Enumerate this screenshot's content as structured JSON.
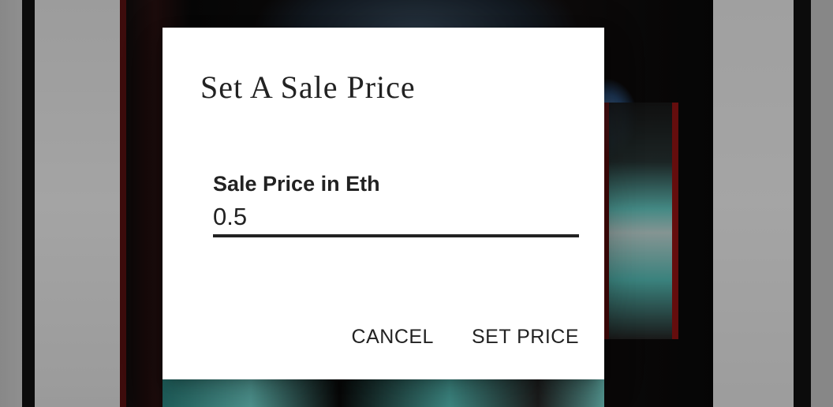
{
  "dialog": {
    "title": "Set A Sale Price",
    "field": {
      "label": "Sale Price in Eth",
      "value": "0.5"
    },
    "actions": {
      "cancel_label": "CANCEL",
      "confirm_label": "SET PRICE"
    }
  },
  "colors": {
    "dialog_background": "#ffffff",
    "text": "#222222",
    "scrim": "rgba(0,0,0,0.32)"
  }
}
